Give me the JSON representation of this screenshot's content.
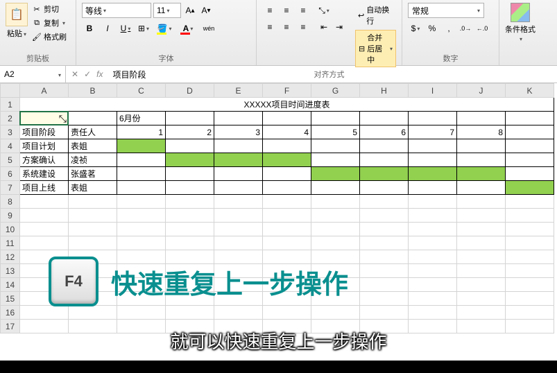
{
  "ribbon": {
    "clipboard": {
      "paste": "粘贴",
      "cut": "剪切",
      "copy": "复制",
      "format_painter": "格式刷",
      "group_label": "剪贴板"
    },
    "font": {
      "name": "等线",
      "size": "11",
      "bold": "B",
      "italic": "I",
      "underline": "U",
      "wen": "wén",
      "group_label": "字体",
      "fill_color": "#ffff00",
      "font_color": "#ff0000"
    },
    "alignment": {
      "wrap": "自动换行",
      "merge": "合并后居中",
      "group_label": "对齐方式"
    },
    "number": {
      "format": "常规",
      "group_label": "数字"
    },
    "cond_format": {
      "label": "条件格式"
    }
  },
  "formula_bar": {
    "cell_ref": "A2",
    "fx": "fx",
    "value": "项目阶段"
  },
  "sheet": {
    "columns": [
      "A",
      "B",
      "C",
      "D",
      "E",
      "F",
      "G",
      "H",
      "I",
      "J",
      "K"
    ],
    "title": "XXXXX项目时间进度表",
    "month_header": "6月份",
    "headers": {
      "a": "项目阶段",
      "b": "责任人"
    },
    "numbers": [
      "1",
      "2",
      "3",
      "4",
      "5",
      "6",
      "7",
      "8"
    ],
    "rows": [
      {
        "a": "项目计划",
        "b": "表姐",
        "green": [
          2
        ]
      },
      {
        "a": "方案确认",
        "b": "凌祯",
        "green": [
          3,
          4,
          5
        ]
      },
      {
        "a": "系统建设",
        "b": "张盛茗",
        "green": [
          6,
          7,
          8,
          9
        ]
      },
      {
        "a": "项目上线",
        "b": "表姐",
        "green": [
          10
        ]
      }
    ]
  },
  "tip": {
    "key": "F4",
    "title": "快速重复上一步操作",
    "subtitle": "就可以快速重复上一步操作"
  }
}
